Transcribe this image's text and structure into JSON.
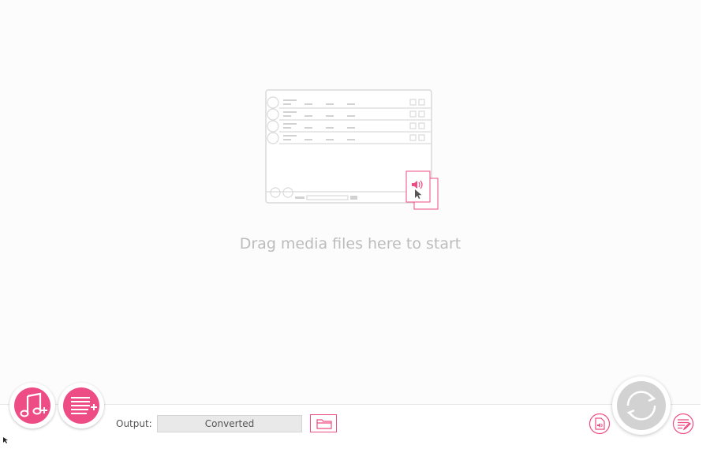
{
  "drop_area": {
    "hint": "Drag media files here to start"
  },
  "toolbar": {
    "add_music_icon": "music-note-plus-icon",
    "add_playlist_icon": "list-plus-icon",
    "output_label": "Output:",
    "output_value": "Converted",
    "folder_icon": "folder-icon",
    "audio_file_icon": "audio-file-icon",
    "settings_icon": "lines-edit-icon",
    "convert_icon": "convert-arrows-icon"
  },
  "colors": {
    "accent": "#ee4c84",
    "convert_disabled": "#d2d2d2",
    "hint_text": "#bcbcbc"
  }
}
